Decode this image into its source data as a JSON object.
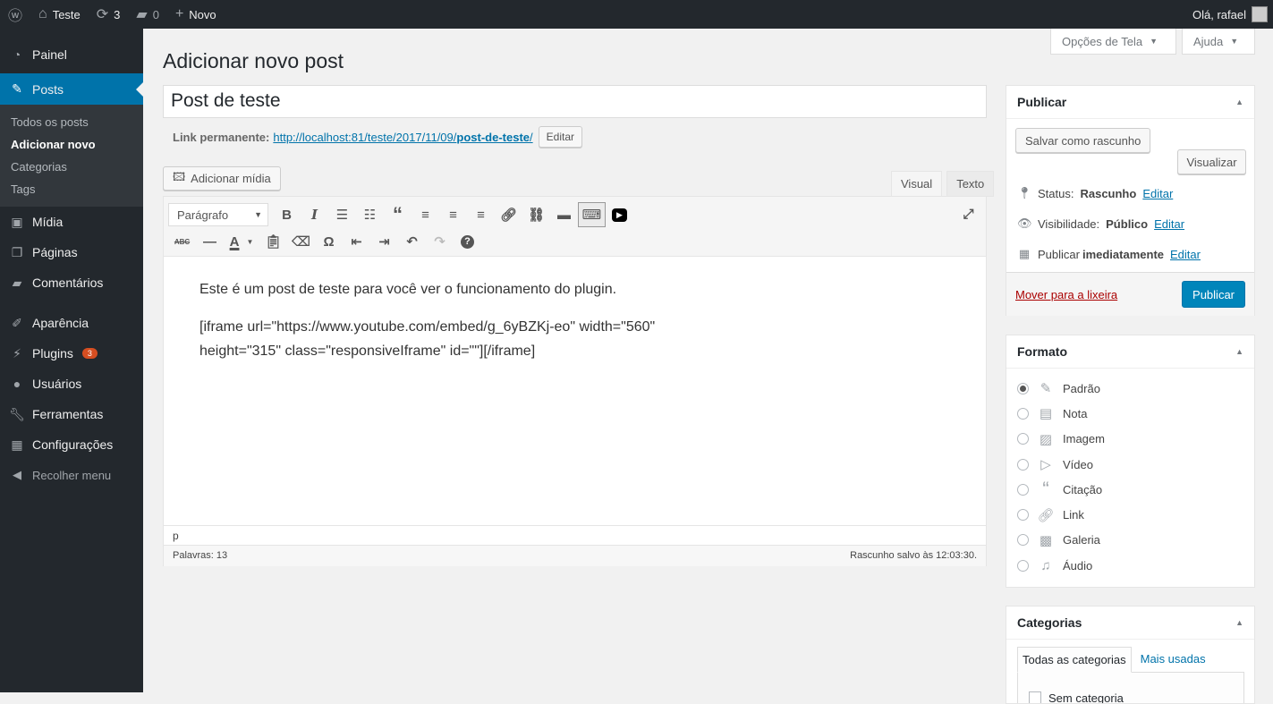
{
  "adminbar": {
    "site": "Teste",
    "updates": "3",
    "comments": "0",
    "new": "Novo",
    "greeting": "Olá, rafael"
  },
  "sidebar": {
    "items": [
      {
        "label": "Painel",
        "icon": "dashboard-icon"
      },
      {
        "label": "Posts",
        "icon": "pin-icon"
      },
      {
        "label": "Mídia",
        "icon": "media-icon"
      },
      {
        "label": "Páginas",
        "icon": "pages-icon"
      },
      {
        "label": "Comentários",
        "icon": "comments-icon"
      },
      {
        "label": "Aparência",
        "icon": "brush-icon"
      },
      {
        "label": "Plugins",
        "icon": "plugin-icon",
        "badge": "3"
      },
      {
        "label": "Usuários",
        "icon": "users-icon"
      },
      {
        "label": "Ferramentas",
        "icon": "wrench-icon"
      },
      {
        "label": "Configurações",
        "icon": "settings-icon"
      }
    ],
    "submenu": [
      "Todos os posts",
      "Adicionar novo",
      "Categorias",
      "Tags"
    ],
    "collapse": "Recolher menu"
  },
  "screen_options": "Opções de Tela",
  "help": "Ajuda",
  "page_title": "Adicionar novo post",
  "post_title": "Post de teste",
  "permalink": {
    "label": "Link permanente:",
    "url_base": "http://localhost:81/teste/2017/11/09/",
    "slug": "post-de-teste",
    "trail": "/",
    "edit": "Editar"
  },
  "add_media": "Adicionar mídia",
  "tabs": {
    "visual": "Visual",
    "text": "Texto"
  },
  "format_select": "Parágrafo",
  "content": {
    "p1": "Este é um post de teste para você ver o funcionamento do plugin.",
    "p2a": "[iframe url=\"https://www.youtube.com/embed/g_6yBZKj-eo\" width=\"560\"",
    "p2b": "height=\"315\" class=\"responsiveIframe\" id=\"\"][/iframe]"
  },
  "path": "p",
  "word_count": "Palavras: 13",
  "draft_saved": "Rascunho salvo às 12:03:30.",
  "publish": {
    "title": "Publicar",
    "save_draft": "Salvar como rascunho",
    "preview": "Visualizar",
    "status_label": "Status:",
    "status": "Rascunho",
    "visibility_label": "Visibilidade:",
    "visibility": "Público",
    "schedule_label": "Publicar",
    "schedule": "imediatamente",
    "edit": "Editar",
    "trash": "Mover para a lixeira",
    "publish": "Publicar"
  },
  "format": {
    "title": "Formato",
    "options": [
      "Padrão",
      "Nota",
      "Imagem",
      "Vídeo",
      "Citação",
      "Link",
      "Galeria",
      "Áudio"
    ],
    "selected": "Padrão"
  },
  "categories": {
    "title": "Categorias",
    "tab_all": "Todas as categorias",
    "tab_popular": "Mais usadas",
    "first": "Sem categoria"
  }
}
